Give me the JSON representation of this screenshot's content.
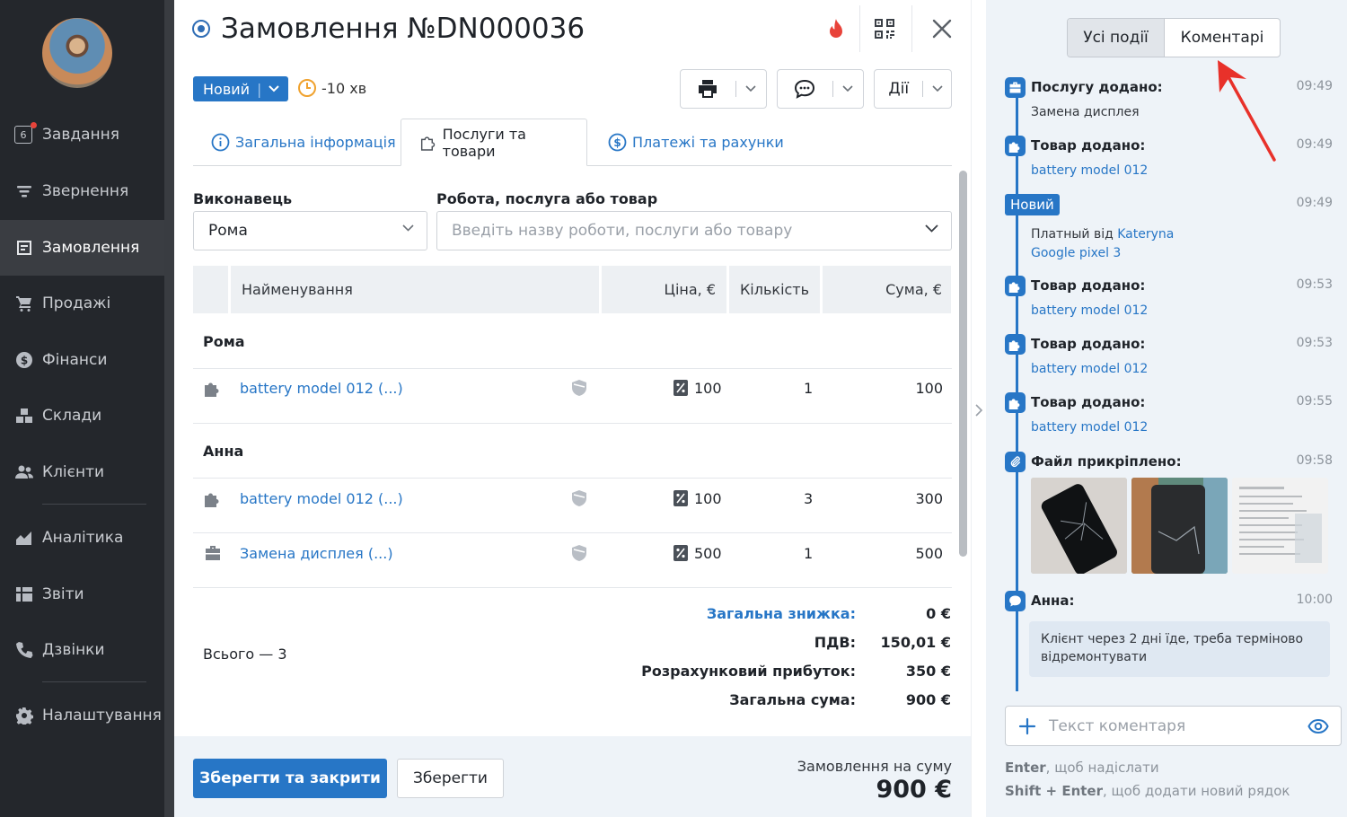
{
  "sidebar": {
    "items": [
      {
        "label": "Завдання",
        "icon": "tasks-icon",
        "badge": "6"
      },
      {
        "label": "Звернення",
        "icon": "funnel-icon"
      },
      {
        "label": "Замовлення",
        "icon": "order-icon",
        "active": true
      },
      {
        "label": "Продажі",
        "icon": "cart-icon"
      },
      {
        "label": "Фінанси",
        "icon": "dollar-icon"
      },
      {
        "label": "Склади",
        "icon": "boxes-icon"
      },
      {
        "label": "Клієнти",
        "icon": "users-icon"
      },
      {
        "label": "Аналітика",
        "icon": "chart-icon"
      },
      {
        "label": "Звіти",
        "icon": "reports-icon"
      },
      {
        "label": "Дзвінки",
        "icon": "phone-icon"
      },
      {
        "label": "Налаштування",
        "icon": "gear-icon"
      }
    ]
  },
  "header": {
    "title": "Замовлення №DN000036",
    "status_label": "Новий",
    "timer": "-10 хв",
    "actions_label": "Дії"
  },
  "tabs": [
    {
      "label": "Загальна інформація",
      "icon": "info-icon"
    },
    {
      "label": "Послуги та товари",
      "icon": "puzzle-icon",
      "active": true
    },
    {
      "label": "Платежі та рахунки",
      "icon": "dollar-circle-icon"
    }
  ],
  "form": {
    "executor_label": "Виконавець",
    "executor_value": "Рома",
    "item_label": "Робота, послуга або товар",
    "item_placeholder": "Введіть назву роботи, послуги або товару"
  },
  "table": {
    "columns": {
      "name": "Найменування",
      "price": "Ціна, €",
      "qty": "Кількість",
      "sum": "Сума, €"
    },
    "groups": [
      {
        "title": "Рома",
        "rows": [
          {
            "name": "battery model 012 (...)",
            "kind": "product",
            "price": "100",
            "qty": "1",
            "sum": "100"
          }
        ]
      },
      {
        "title": "Анна",
        "rows": [
          {
            "name": "battery model 012 (...)",
            "kind": "product",
            "price": "100",
            "qty": "3",
            "sum": "300"
          },
          {
            "name": "Замена дисплея (...)",
            "kind": "service",
            "price": "500",
            "qty": "1",
            "sum": "500"
          }
        ]
      }
    ]
  },
  "totals": {
    "count_label": "Всього — 3",
    "discount_label": "Загальна знижка:",
    "discount_value": "0 €",
    "vat_label": "ПДВ:",
    "vat_value": "150,01 €",
    "profit_label": "Розрахунковий прибуток:",
    "profit_value": "350 €",
    "total_label": "Загальна сума:",
    "total_value": "900 €"
  },
  "footer": {
    "save_close_label": "Зберегти та закрити",
    "save_label": "Зберегти",
    "order_sum_label": "Замовлення на суму",
    "order_sum_value": "900 €"
  },
  "right_panel": {
    "tab_all": "Усі події",
    "tab_comments": "Коментарі",
    "events": [
      {
        "icon": "briefcase-icon",
        "title": "Послугу додано:",
        "time": "09:49",
        "sub": "Замена дисплея",
        "sub_link": false
      },
      {
        "icon": "puzzle-icon",
        "title": "Товар додано:",
        "time": "09:49",
        "sub": "battery model 012",
        "sub_link": true
      },
      {
        "badge": "Новий",
        "time": "09:49",
        "line1_prefix": "Платный від ",
        "line1_link": "Kateryna",
        "line2_link": "Google pixel 3"
      },
      {
        "icon": "puzzle-icon",
        "title": "Товар додано:",
        "time": "09:53",
        "sub": "battery model 012",
        "sub_link": true
      },
      {
        "icon": "puzzle-icon",
        "title": "Товар додано:",
        "time": "09:53",
        "sub": "battery model 012",
        "sub_link": true
      },
      {
        "icon": "puzzle-icon",
        "title": "Товар додано:",
        "time": "09:55",
        "sub": "battery model 012",
        "sub_link": true
      },
      {
        "icon": "paperclip-icon",
        "title": "Файл прикріплено:",
        "time": "09:58"
      },
      {
        "icon": "chat-icon",
        "title": "Анна:",
        "time": "10:00",
        "comment": "Клієнт через 2 дні їде, треба терміново відремонтувати"
      }
    ],
    "comment_placeholder": "Текст коментаря",
    "hint1_key": "Enter",
    "hint1_text": ", щоб надіслати",
    "hint2_key": "Shift + Enter",
    "hint2_text": ", щоб додати новий рядок"
  },
  "colors": {
    "accent": "#2776c6",
    "sidebar": "#24272c",
    "panel": "#eef3f8",
    "alert_red": "#e8433a"
  }
}
